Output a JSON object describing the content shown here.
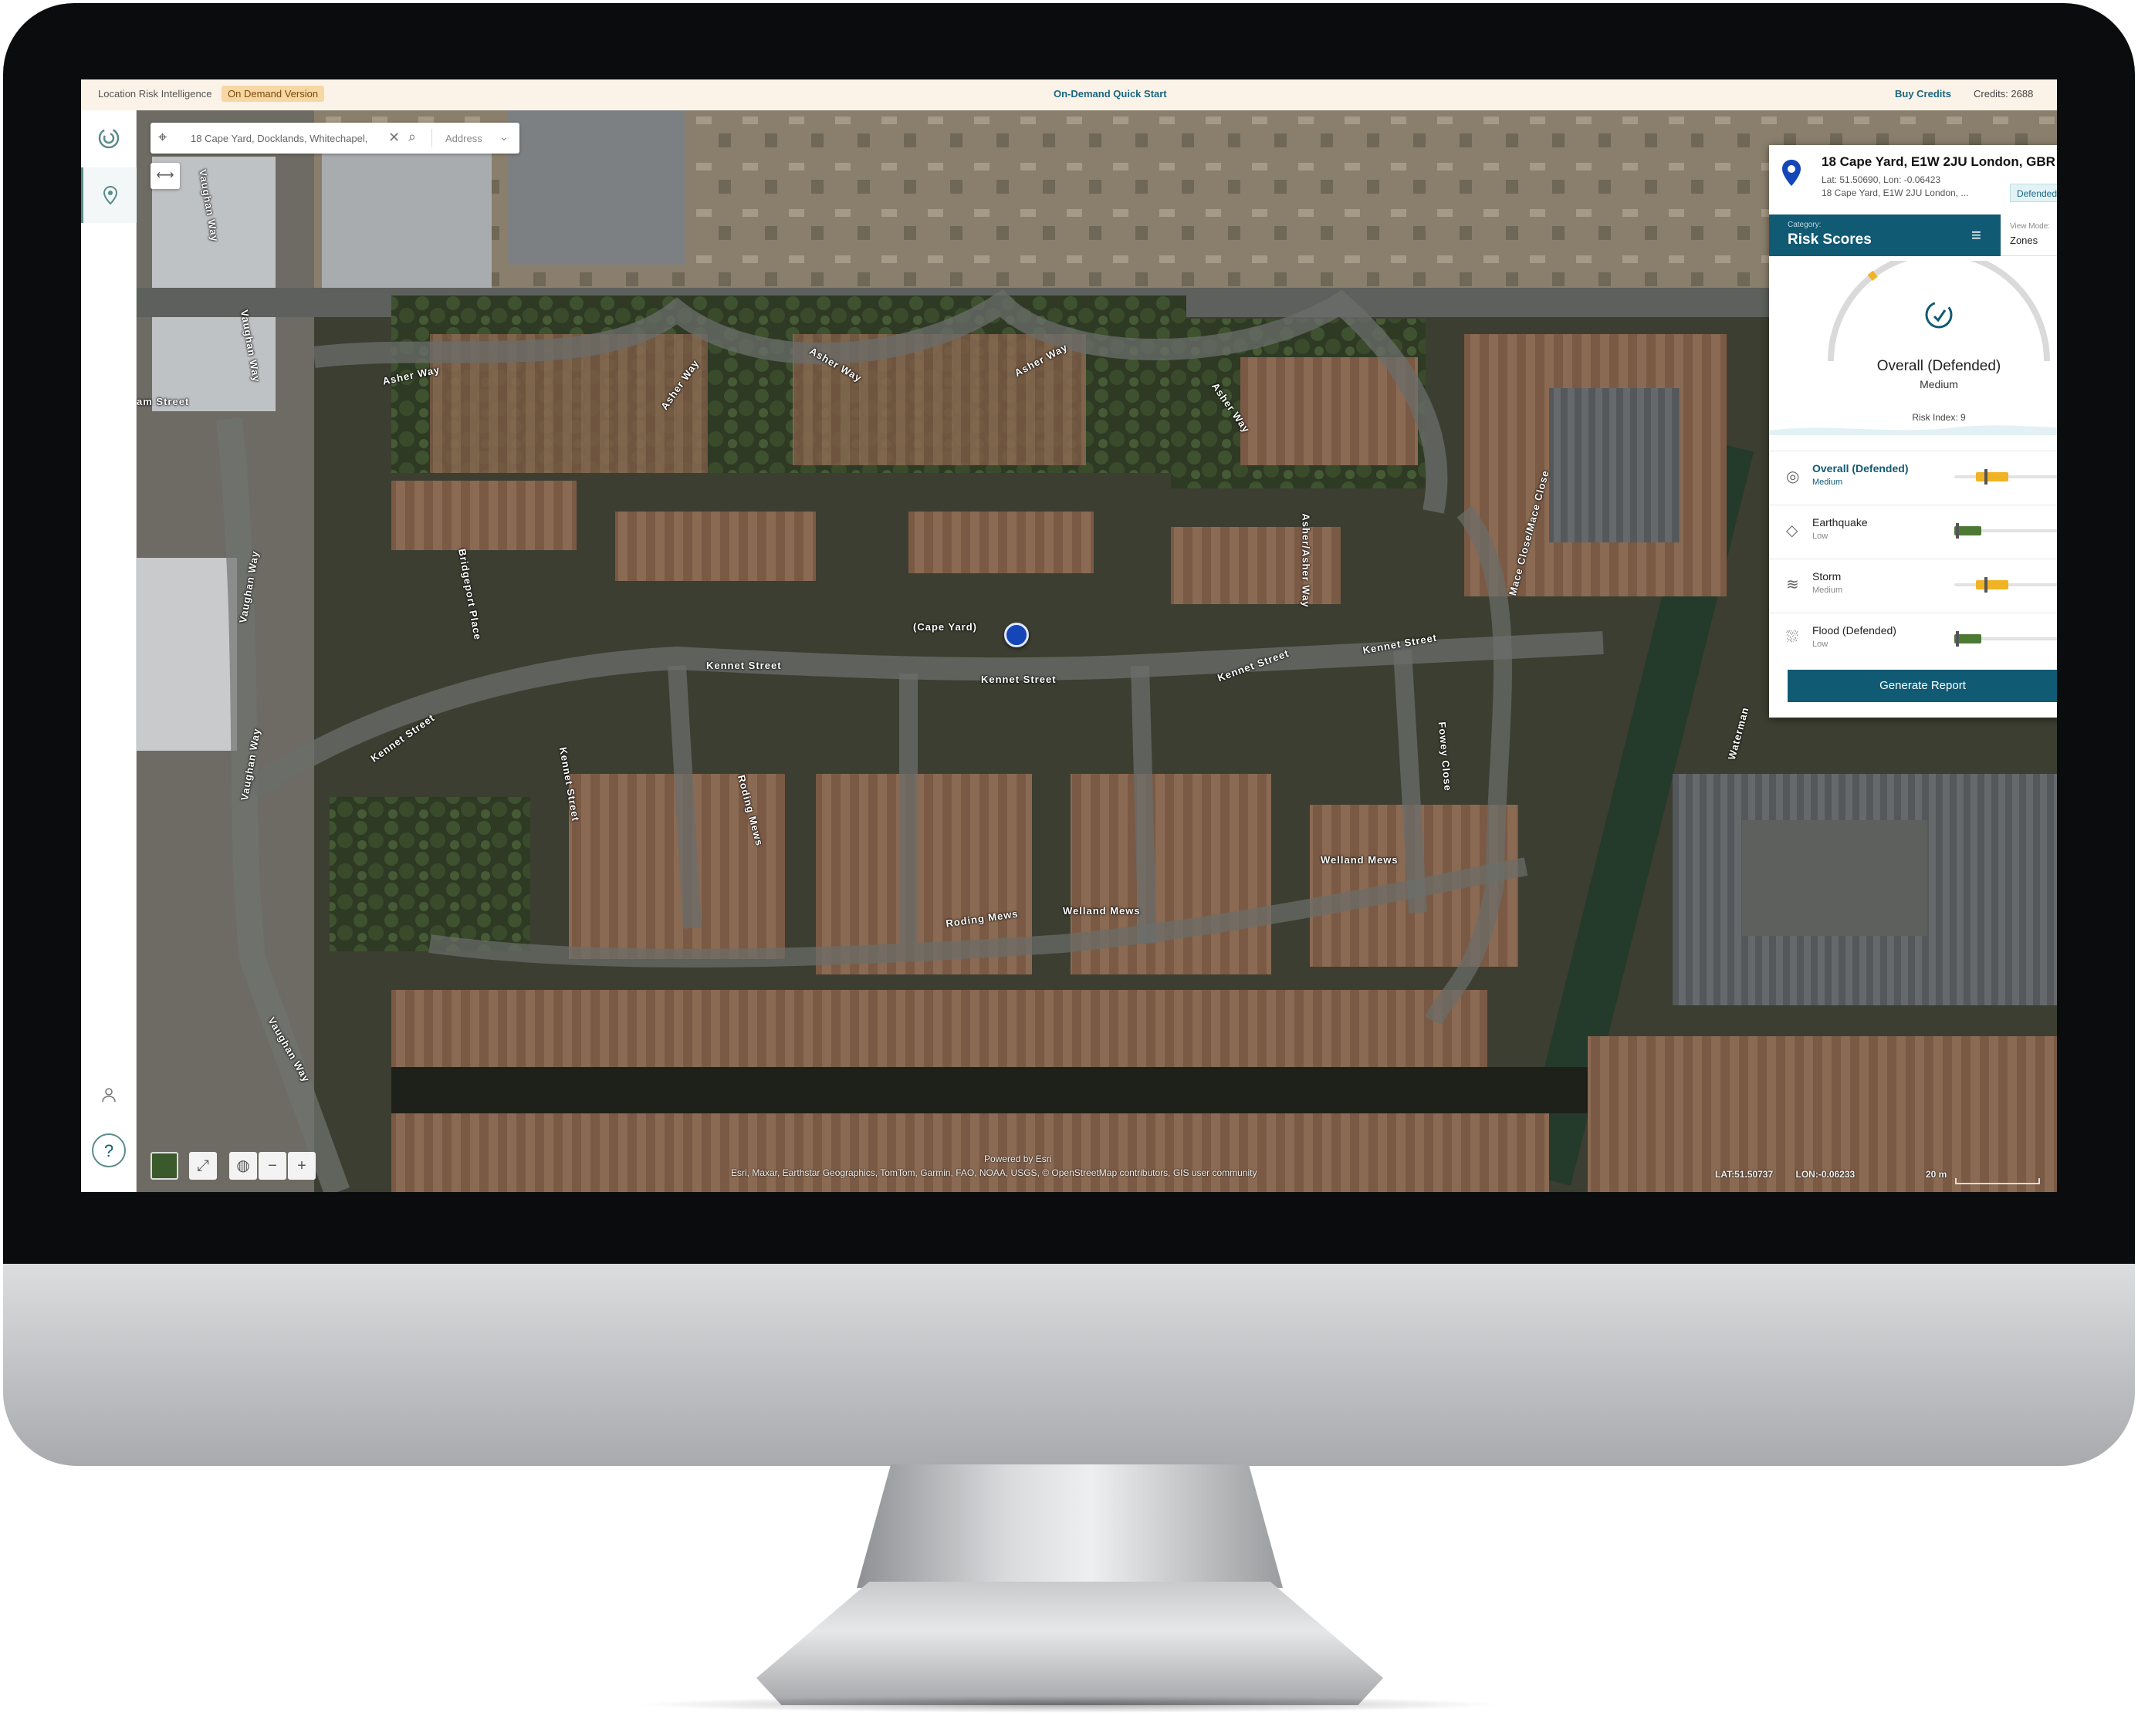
{
  "topbar": {
    "brand": "Location Risk Intelligence",
    "version_badge": "On Demand Version",
    "quick_start": "On-Demand Quick Start",
    "buy_credits": "Buy Credits",
    "credits": "Credits: 2688"
  },
  "search": {
    "value": "18 Cape Yard, Docklands, Whitechapel,",
    "type_selector": "Address"
  },
  "map": {
    "streets": [
      "Asher Way",
      "Asher Way",
      "Asher Way",
      "Asher Way",
      "Asher Way",
      "Asher/Asher Way",
      "Kennet Street",
      "Kennet Street",
      "Kennet Street",
      "Kennet Street",
      "Kennet Street",
      "Kennet Street",
      "Vaughan Way",
      "Vaughan Way",
      "Vaughan Way",
      "Vaughan Way",
      "Vaughan Way",
      "Bridgeport Place",
      "Mace Close/Mace Close",
      "Fowey Close",
      "Roding Mews",
      "Roding Mews",
      "Welland Mews",
      "Welland Mews",
      "(Cape Yard)",
      "am Street",
      "Waterman"
    ],
    "powered_by": "Powered by Esri",
    "attribution": "Esri, Maxar, Earthstar Geographics, TomTom, Garmin, FAO, NOAA, USGS, © OpenStreetMap contributors, GIS user community",
    "lat": "LAT:51.50737",
    "lon": "LON:-0.06233",
    "scale": "20 m",
    "controls": [
      "−",
      "+"
    ]
  },
  "panel": {
    "title": "18 Cape Yard, E1W 2JU London, GBR",
    "latlon": "Lat: 51.50690, Lon: -0.06423",
    "address": "18 Cape Yard, E1W 2JU London, ...",
    "defended": "Defended",
    "category_label": "Category:",
    "category_value": "Risk Scores",
    "view_mode_label": "View Mode:",
    "view_mode_value": "Zones",
    "gauge_title": "Overall (Defended)",
    "gauge_level": "Medium",
    "risk_index": "Risk Index:  9",
    "gauge_fraction": 0.3,
    "rows": [
      {
        "name": "Overall (Defended)",
        "level": "Medium",
        "fraction": 0.4,
        "color": "#f0b323",
        "icon": "overall-defended-icon",
        "highlight": true
      },
      {
        "name": "Earthquake",
        "level": "Low",
        "fraction": 0.2,
        "color": "#4c7a35",
        "icon": "earthquake-icon",
        "highlight": false
      },
      {
        "name": "Storm",
        "level": "Medium",
        "fraction": 0.4,
        "color": "#f0b323",
        "icon": "storm-icon",
        "highlight": false
      },
      {
        "name": "Flood (Defended)",
        "level": "Low",
        "fraction": 0.2,
        "color": "#4c7a35",
        "icon": "flood-defended-icon",
        "highlight": false
      }
    ],
    "generate_report": "Generate Report"
  },
  "colors": {
    "accent": "#115a74",
    "medium": "#f0b323",
    "low": "#4c7a35"
  }
}
